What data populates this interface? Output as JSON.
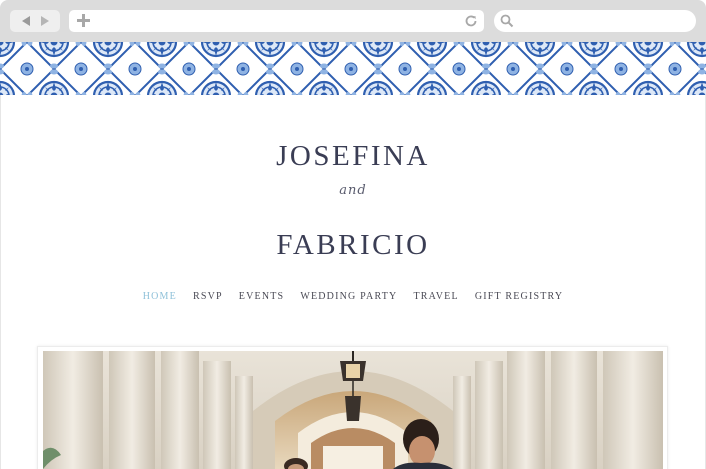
{
  "browser": {
    "nav_back": "back-arrow-icon",
    "nav_forward": "forward-arrow-icon",
    "new_tab": "plus-icon",
    "reload": "reload-icon",
    "search": "search-icon"
  },
  "site": {
    "name_first": "JOSEFINA",
    "connector": "and",
    "name_second": "FABRICIO"
  },
  "nav": {
    "items": [
      {
        "label": "HOME",
        "active": true
      },
      {
        "label": "RSVP"
      },
      {
        "label": "EVENTS"
      },
      {
        "label": "WEDDING PARTY"
      },
      {
        "label": "TRAVEL"
      },
      {
        "label": "GIFT REGISTRY"
      }
    ]
  },
  "colors": {
    "tile_blue": "#2f5fb0",
    "tile_light": "#8fb3e3",
    "name_text": "#3a3d54",
    "nav_active": "#8fc1d9"
  }
}
